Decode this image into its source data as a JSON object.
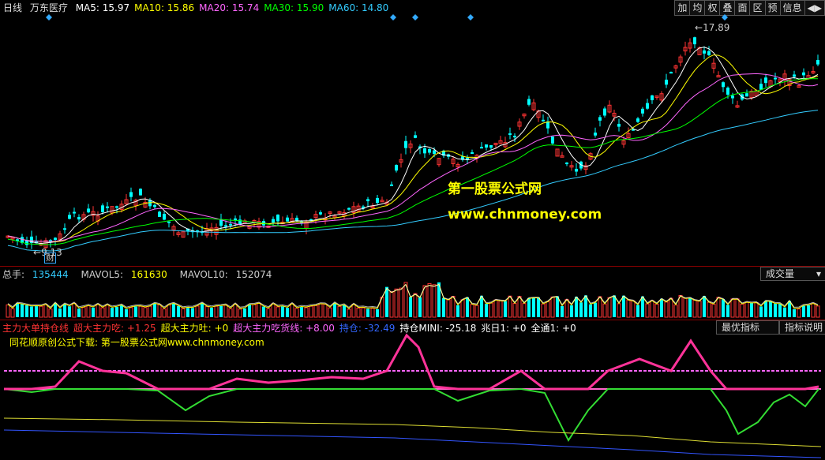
{
  "topbar": {
    "period": "日线",
    "stock_name": "万东医疗",
    "ma": [
      {
        "label": "MA5: 15.97",
        "color": "#ffffff"
      },
      {
        "label": "MA10: 15.86",
        "color": "#ffff00"
      },
      {
        "label": "MA20: 15.74",
        "color": "#ff66ff"
      },
      {
        "label": "MA30: 15.90",
        "color": "#00ff00"
      },
      {
        "label": "MA60: 14.80",
        "color": "#33ccff"
      }
    ],
    "buttons": [
      "加",
      "均",
      "权",
      "叠",
      "面",
      "区",
      "预",
      "信息",
      "◀▶"
    ]
  },
  "main_chart": {
    "price_high_label": "17.89",
    "price_low_label": "9.13",
    "finance_marker": "财",
    "watermark_title": "第一股票公式网",
    "watermark_url": "www.chnmoney.com"
  },
  "volume_panel": {
    "total": {
      "label": "总手: ",
      "value": "135444"
    },
    "mavol5": {
      "label": "MAVOL5: ",
      "value": "161630"
    },
    "mavol10": {
      "label": "MAVOL10: ",
      "value": "152074"
    },
    "selector": "成交量"
  },
  "indicator_panel": {
    "items": [
      {
        "label": "主力大单持仓线",
        "color": "#ff3333"
      },
      {
        "label": "超大主力吃: +1.25",
        "color": "#ff3333"
      },
      {
        "label": "超大主力吐: +0",
        "color": "#ffff00"
      },
      {
        "label": "超大主力吃货线: +8.00",
        "color": "#ff66ff"
      },
      {
        "label": "持仓: -32.49",
        "color": "#3366ff"
      },
      {
        "label": "持仓MINI: -25.18",
        "color": "#ffffff"
      },
      {
        "label": "兆日1: +0",
        "color": "#ffffff"
      },
      {
        "label": "全通1: +0",
        "color": "#ffffff"
      }
    ],
    "btn_best": "最优指标",
    "btn_help": "指标说明",
    "subtitle": "同花顺原创公式下载: 第一股票公式网www.chnmoney.com"
  },
  "colors": {
    "up": "#ff3333",
    "down": "#00ffff",
    "ma5": "#ffffff",
    "ma10": "#ffff00",
    "ma20": "#ff66ff",
    "ma30": "#00ff00",
    "ma60": "#33ccff",
    "marker": "#33aaff"
  }
}
